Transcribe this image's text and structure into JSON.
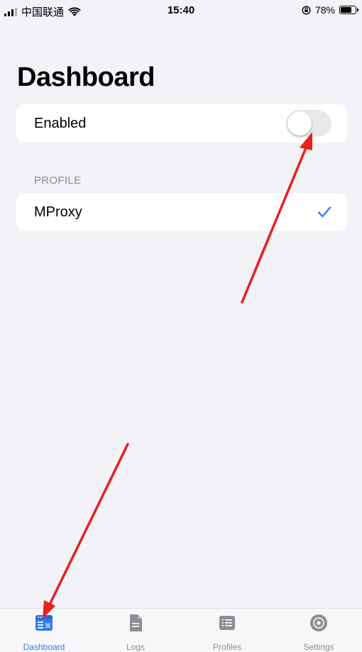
{
  "status_bar": {
    "carrier": "中国联通",
    "time": "15:40",
    "battery_percent": "78%",
    "battery_level": 0.78
  },
  "page": {
    "title": "Dashboard"
  },
  "enabled_row": {
    "label": "Enabled",
    "toggle_on": false
  },
  "profile_section": {
    "header": "PROFILE",
    "selected_profile": "MProxy"
  },
  "tab_bar": {
    "items": [
      {
        "label": "Dashboard",
        "icon": "dashboard-icon",
        "active": true
      },
      {
        "label": "Logs",
        "icon": "logs-icon",
        "active": false
      },
      {
        "label": "Profiles",
        "icon": "profiles-icon",
        "active": false
      },
      {
        "label": "Settings",
        "icon": "settings-icon",
        "active": false
      }
    ]
  },
  "colors": {
    "accent": "#3478F6",
    "inactive_tab": "#8E8E93",
    "background": "#F2F2F7",
    "annotation_arrow": "#E8201E"
  }
}
